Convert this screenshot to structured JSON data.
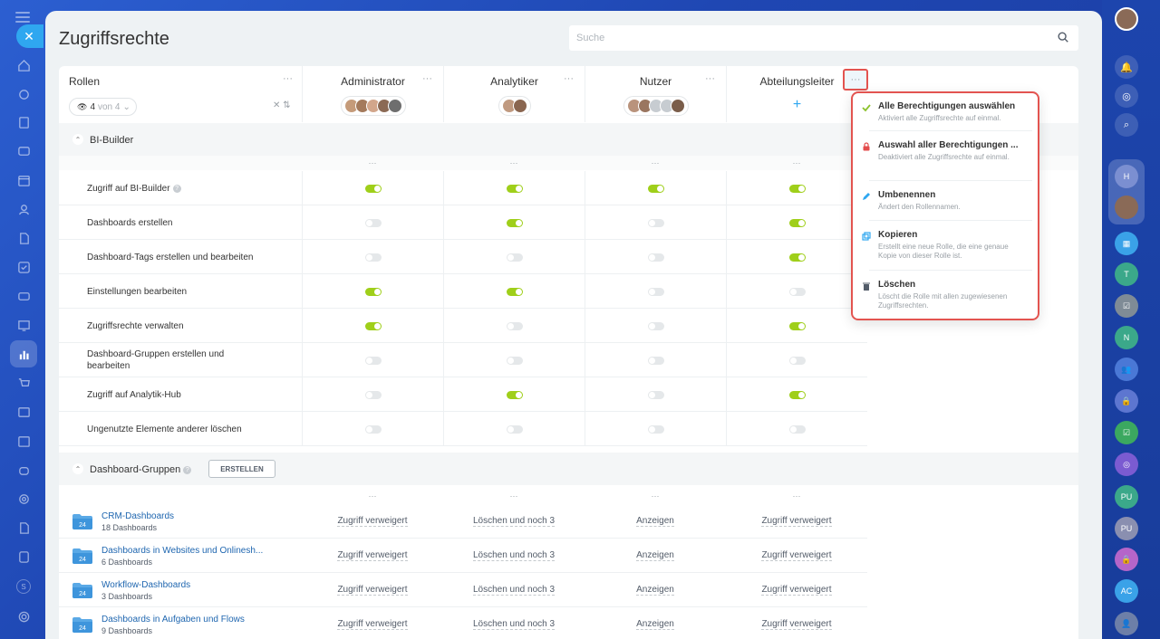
{
  "page": {
    "title": "Zugriffsrechte",
    "search_placeholder": "Suche"
  },
  "roles_header": {
    "label": "Rollen",
    "filter_count": "4",
    "filter_of": "von 4"
  },
  "columns": [
    {
      "name": "Administrator",
      "avatars": [
        "#c59b7a",
        "#a47a5c",
        "#d2a68b",
        "#8b6a55",
        "#6e6e6e"
      ]
    },
    {
      "name": "Analytiker",
      "avatars": [
        "#c09a80",
        "#8a6650"
      ]
    },
    {
      "name": "Nutzer",
      "avatars": [
        "#b9937c",
        "#9a7660",
        "#c7ccd1",
        "#c7ccd1",
        "#7a5d4a"
      ]
    },
    {
      "name": "Abteilungsleiter",
      "avatars": []
    }
  ],
  "section_bi": {
    "label": "BI-Builder"
  },
  "permissions": [
    {
      "label": "Zugriff auf BI-Builder",
      "help": true,
      "values": [
        true,
        true,
        true,
        true
      ]
    },
    {
      "label": "Dashboards erstellen",
      "help": false,
      "values": [
        false,
        true,
        false,
        true
      ]
    },
    {
      "label": "Dashboard-Tags erstellen und bearbeiten",
      "help": false,
      "values": [
        false,
        false,
        false,
        true
      ]
    },
    {
      "label": "Einstellungen bearbeiten",
      "help": false,
      "values": [
        true,
        true,
        false,
        false
      ]
    },
    {
      "label": "Zugriffsrechte verwalten",
      "help": false,
      "values": [
        true,
        false,
        false,
        true
      ]
    },
    {
      "label": "Dashboard-Gruppen erstellen und bearbeiten",
      "help": false,
      "values": [
        false,
        false,
        false,
        false
      ]
    },
    {
      "label": "Zugriff auf Analytik-Hub",
      "help": false,
      "values": [
        false,
        true,
        false,
        true
      ]
    },
    {
      "label": "Ungenutzte Elemente anderer löschen",
      "help": false,
      "values": [
        false,
        false,
        false,
        false
      ]
    }
  ],
  "section_groups": {
    "label": "Dashboard-Gruppen",
    "create_label": "ERSTELLEN"
  },
  "groups": [
    {
      "name": "CRM-Dashboards",
      "count": "18 Dashboards",
      "cells": [
        "Zugriff verweigert",
        "Löschen und noch 3",
        "Anzeigen",
        "Zugriff verweigert"
      ]
    },
    {
      "name": "Dashboards in Websites und Onlinesh...",
      "count": "6 Dashboards",
      "cells": [
        "Zugriff verweigert",
        "Löschen und noch 3",
        "Anzeigen",
        "Zugriff verweigert"
      ]
    },
    {
      "name": "Workflow-Dashboards",
      "count": "3 Dashboards",
      "cells": [
        "Zugriff verweigert",
        "Löschen und noch 3",
        "Anzeigen",
        "Zugriff verweigert"
      ]
    },
    {
      "name": "Dashboards in Aufgaben und Flows",
      "count": "9 Dashboards",
      "cells": [
        "Zugriff verweigert",
        "Löschen und noch 3",
        "Anzeigen",
        "Zugriff verweigert"
      ]
    }
  ],
  "menu": {
    "items": [
      {
        "title": "Alle Berechtigungen auswählen",
        "desc": "Aktiviert alle Zugriffsrechte auf einmal."
      },
      {
        "title": "Auswahl aller Berechtigungen ...",
        "desc": "Deaktiviert alle Zugriffsrechte auf einmal."
      },
      {
        "title": "Umbenennen",
        "desc": "Ändert den Rollennamen."
      },
      {
        "title": "Kopieren",
        "desc": "Erstellt eine neue Rolle, die eine genaue Kopie von dieser Rolle ist."
      },
      {
        "title": "Löschen",
        "desc": "Löscht die Rolle mit allen zugewiesenen Zugriffsrechten."
      }
    ]
  },
  "right_sidebar": {
    "avatars": [
      "H",
      "T",
      "N",
      "PU",
      "PU",
      "AC"
    ]
  },
  "left_sidebar": {
    "bottom_badge": "S"
  },
  "colors": {
    "accent": "#2fa7f0",
    "toggle_on": "#9fcf1a",
    "highlight": "#e35450",
    "link": "#2067b0"
  }
}
